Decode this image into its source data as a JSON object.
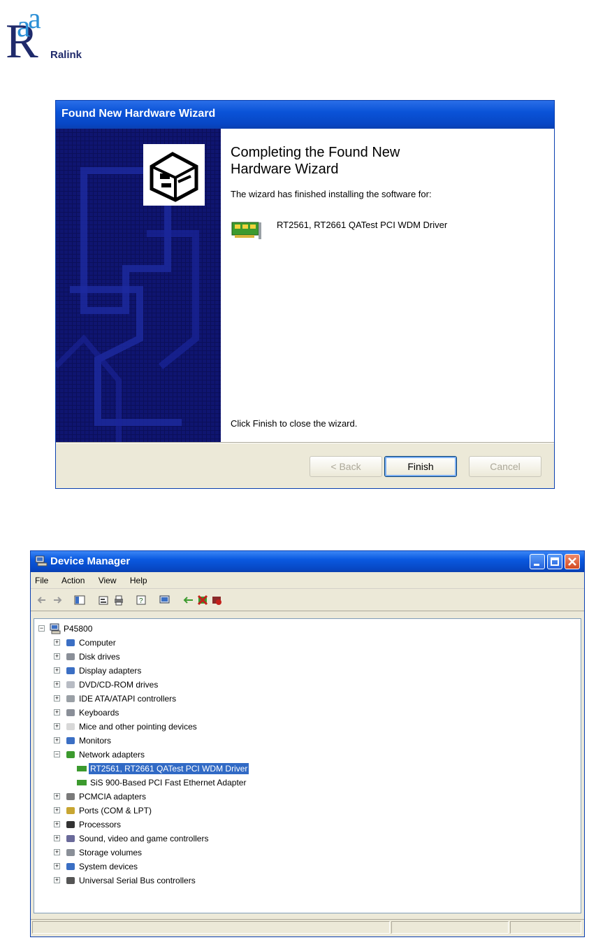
{
  "logo": {
    "text": "Ralink"
  },
  "wizard": {
    "title": "Found New Hardware Wizard",
    "heading_line1": "Completing the Found New",
    "heading_line2": "Hardware Wizard",
    "message": "The wizard has finished installing the software for:",
    "device_name": "RT2561, RT2661 QATest PCI WDM Driver",
    "footer_text": "Click Finish to close the wizard.",
    "buttons": {
      "back": "< Back",
      "finish": "Finish",
      "cancel": "Cancel"
    }
  },
  "device_manager": {
    "title": "Device Manager",
    "menu": [
      "File",
      "Action",
      "View",
      "Help"
    ],
    "root": "P45800",
    "categories": [
      {
        "label": "Computer",
        "icon": "computer-icon"
      },
      {
        "label": "Disk drives",
        "icon": "disk-drive-icon"
      },
      {
        "label": "Display adapters",
        "icon": "display-icon"
      },
      {
        "label": "DVD/CD-ROM drives",
        "icon": "cdrom-icon"
      },
      {
        "label": "IDE ATA/ATAPI controllers",
        "icon": "ide-controller-icon"
      },
      {
        "label": "Keyboards",
        "icon": "keyboard-icon"
      },
      {
        "label": "Mice and other pointing devices",
        "icon": "mouse-icon"
      },
      {
        "label": "Monitors",
        "icon": "monitor-icon"
      },
      {
        "label": "Network adapters",
        "icon": "network-adapter-icon"
      },
      {
        "label": "PCMCIA adapters",
        "icon": "pcmcia-icon"
      },
      {
        "label": "Ports (COM & LPT)",
        "icon": "port-icon"
      },
      {
        "label": "Processors",
        "icon": "processor-icon"
      },
      {
        "label": "Sound, video and game controllers",
        "icon": "sound-icon"
      },
      {
        "label": "Storage volumes",
        "icon": "storage-icon"
      },
      {
        "label": "System devices",
        "icon": "system-device-icon"
      },
      {
        "label": "Universal Serial Bus controllers",
        "icon": "usb-icon"
      }
    ],
    "network_children": [
      {
        "label": "RT2561, RT2661 QATest PCI WDM Driver",
        "selected": true
      },
      {
        "label": "SiS 900-Based PCI Fast Ethernet Adapter",
        "selected": false
      }
    ]
  },
  "colors": {
    "title_blue": "#0a53d8",
    "sidebar_navy": "#0b0f5a",
    "selection_blue": "#316ac5",
    "dialog_face": "#ece9d8"
  }
}
